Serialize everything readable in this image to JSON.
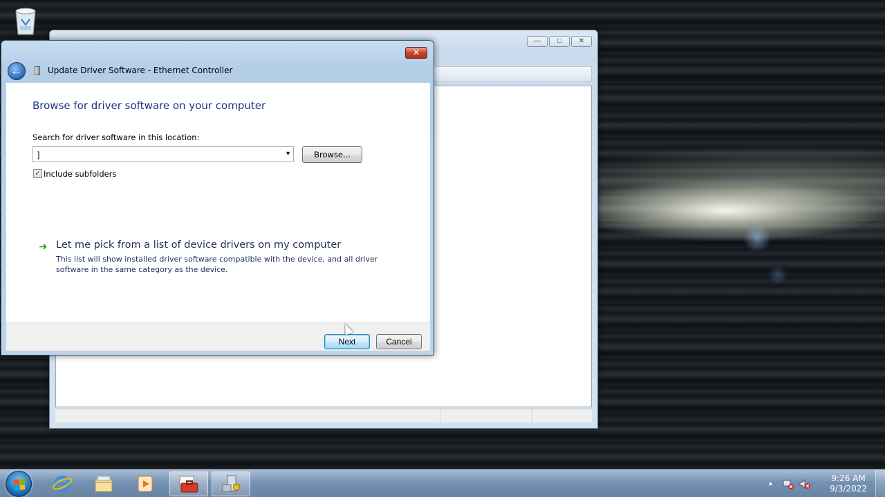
{
  "dialog": {
    "title": "Update Driver Software - Ethernet Controller",
    "close_label": "✕",
    "heading": "Browse for driver software on your computer",
    "search_label": "Search for driver software in this location:",
    "path_value": "]",
    "browse_label": "Browse...",
    "include_subfolders_label": "Include subfolders",
    "include_subfolders_checked": true,
    "pick_link": "Let me pick from a list of device drivers on my computer",
    "pick_description": "This list will show installed driver software compatible with the device, and all driver software in the same category as the device.",
    "next_label": "Next",
    "cancel_label": "Cancel"
  },
  "taskbar": {
    "clock_time": "9:26 AM",
    "clock_date": "9/3/2022",
    "pinned": [
      "internet-explorer",
      "windows-explorer",
      "windows-media-player",
      "toolbox",
      "device-manager"
    ]
  },
  "icons": {
    "recycle_bin": "recycle-bin-icon",
    "back": "back-arrow-icon",
    "device": "device-icon",
    "pick_arrow": "green-arrow-icon"
  },
  "colors": {
    "heading": "#1e3287",
    "link": "#1e2f5a",
    "close_button": "#c8462f",
    "taskbar": "#6e8caf"
  }
}
